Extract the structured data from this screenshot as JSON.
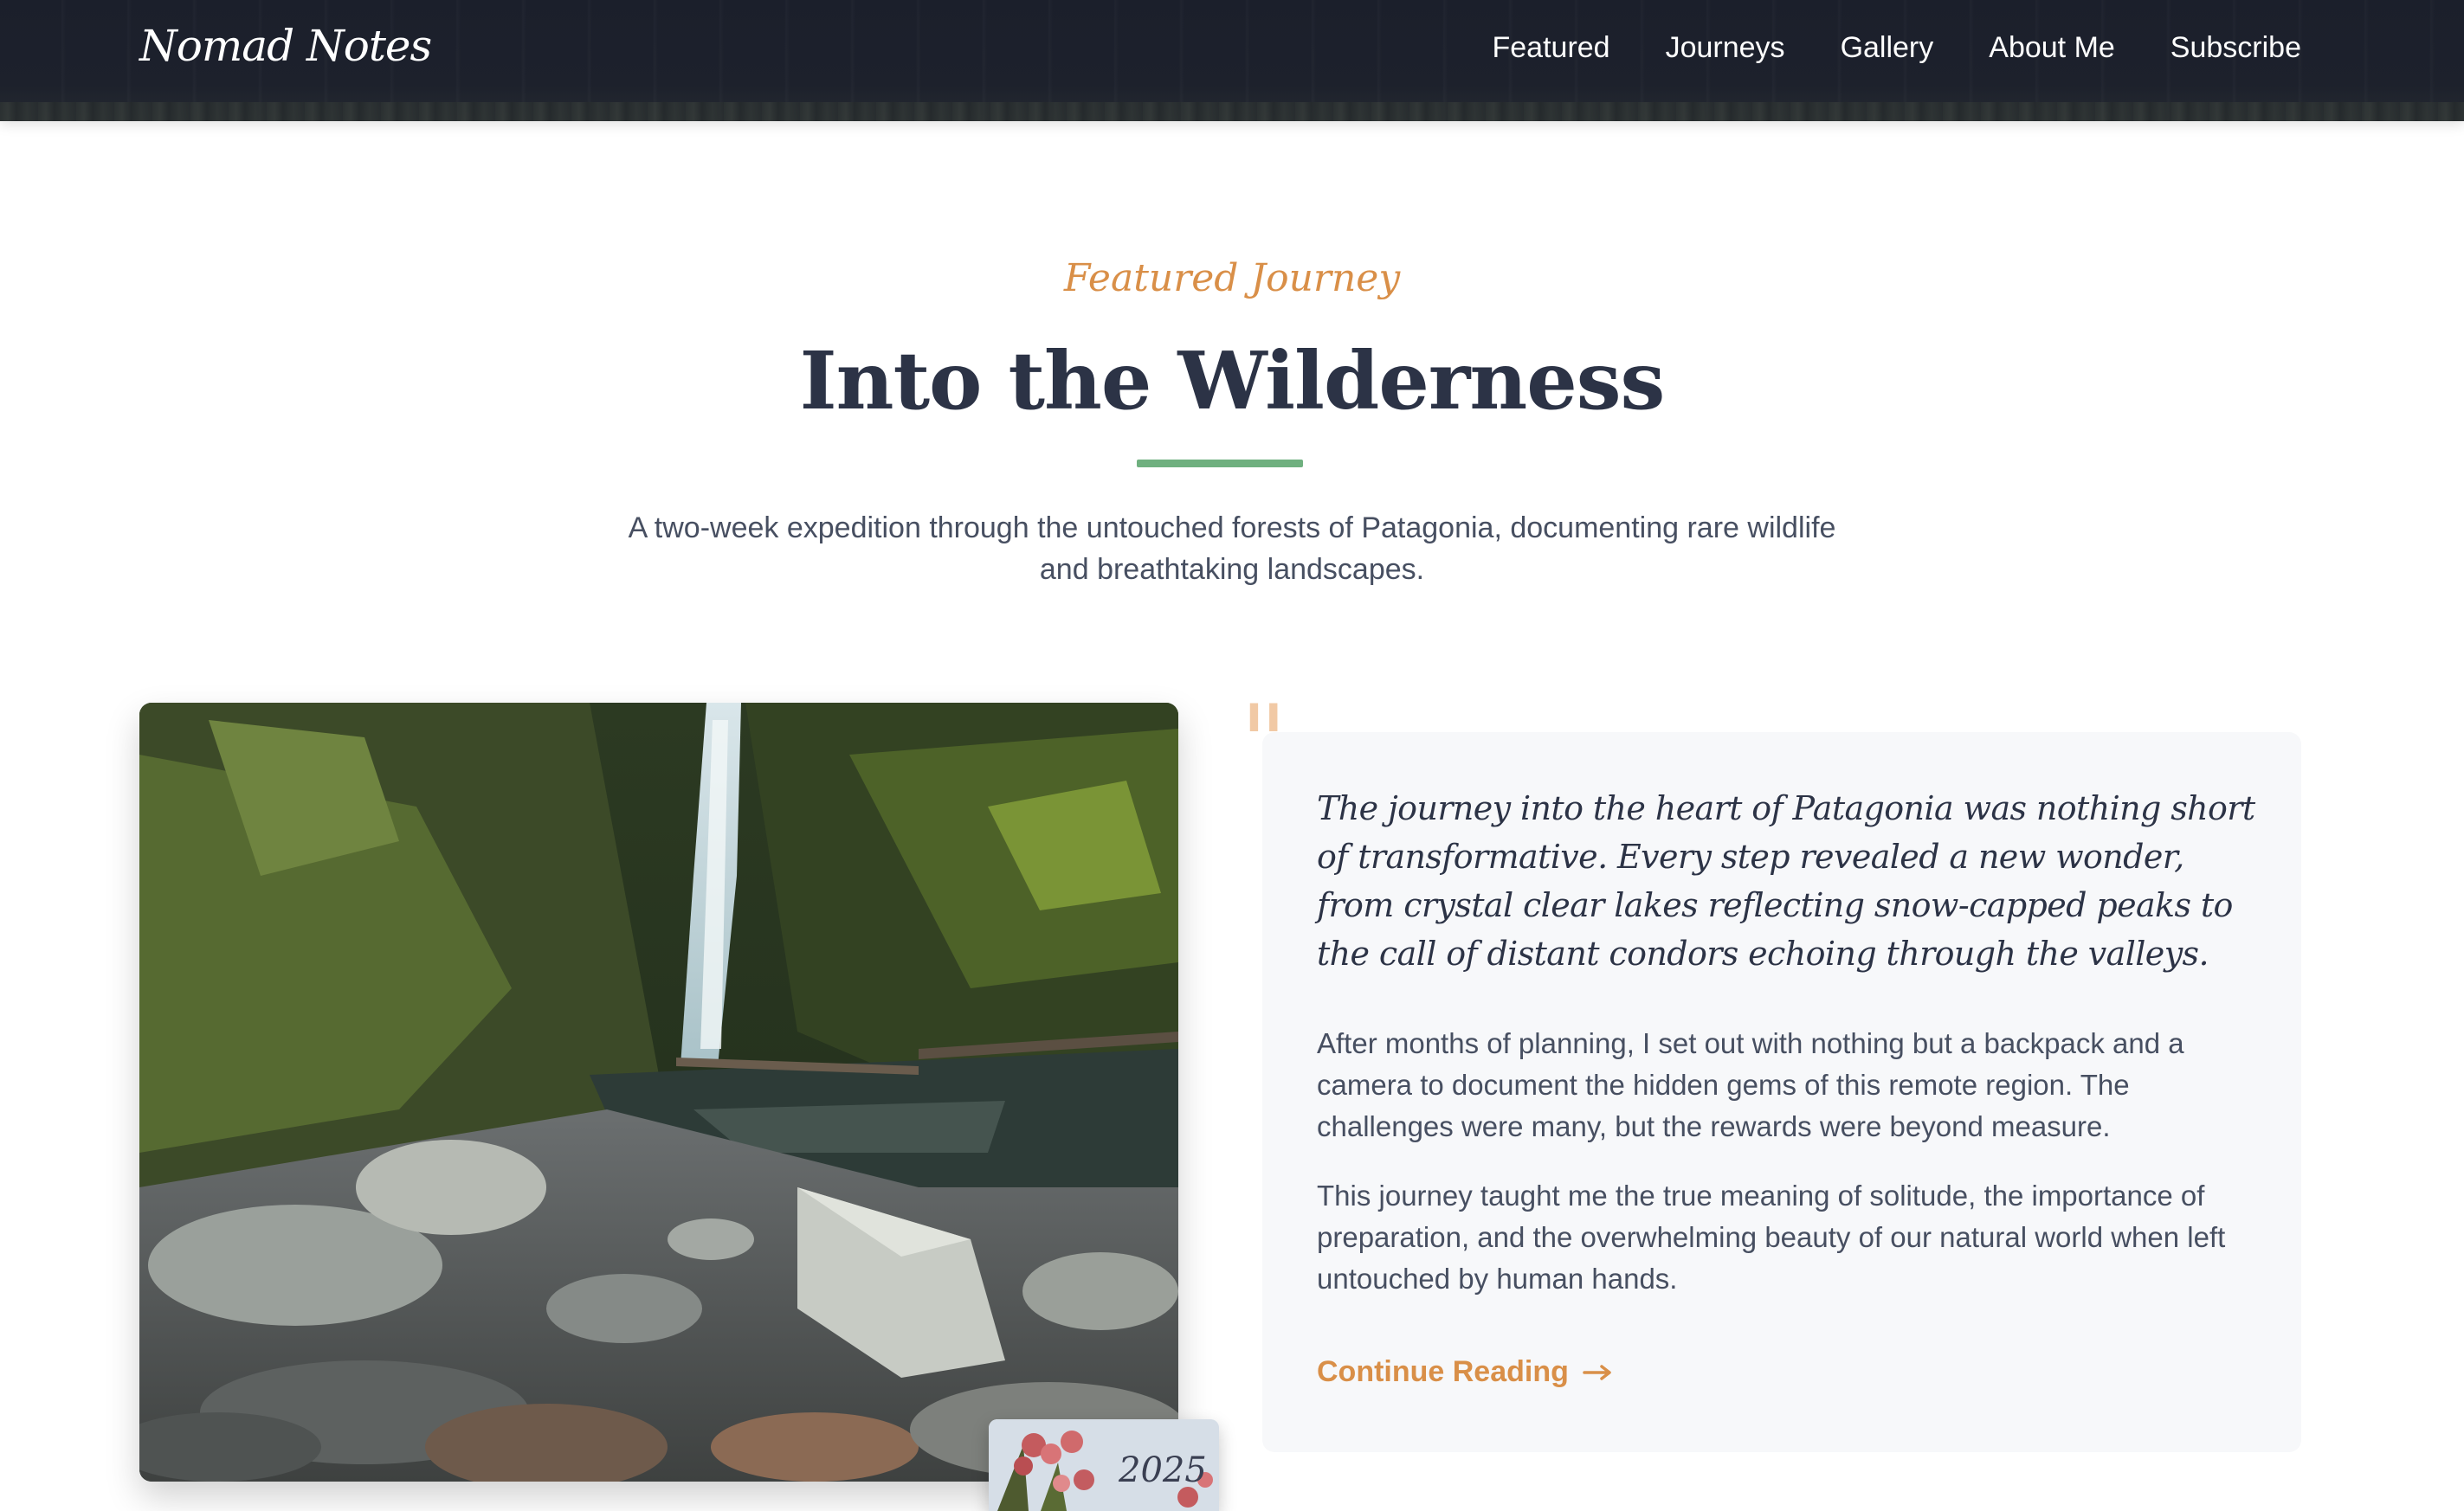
{
  "nav": {
    "logo": "Nomad Notes",
    "links": [
      "Featured",
      "Journeys",
      "Gallery",
      "About Me",
      "Subscribe"
    ]
  },
  "header": {
    "eyebrow": "Featured Journey",
    "title": "Into the Wilderness",
    "subtitle": "A two-week expedition through the untouched forests of Patagonia, documenting rare wildlife and breathtaking landscapes."
  },
  "image": {
    "icon": "waterfall-photo",
    "stamp_year": "2025"
  },
  "article": {
    "quote": "The journey into the heart of Patagonia was nothing short of transformative. Every step revealed a new wonder, from crystal clear lakes reflecting snow-capped peaks to the call of distant condors echoing through the valleys.",
    "paragraph_1": "After months of planning, I set out with nothing but a backpack and a camera to document the hidden gems of this remote region. The challenges were many, but the rewards were beyond measure.",
    "paragraph_2": "This journey taught me the true meaning of solitude, the importance of preparation, and the overwhelming beauty of our natural world when left untouched by human hands.",
    "cta_label": "Continue Reading"
  },
  "colors": {
    "nav_bg": "#1b1f2b",
    "accent_orange": "#d98f48",
    "accent_green": "#6fb07f",
    "heading": "#2c3346",
    "body_text": "#474f61",
    "card_bg": "#f7f8fa"
  }
}
